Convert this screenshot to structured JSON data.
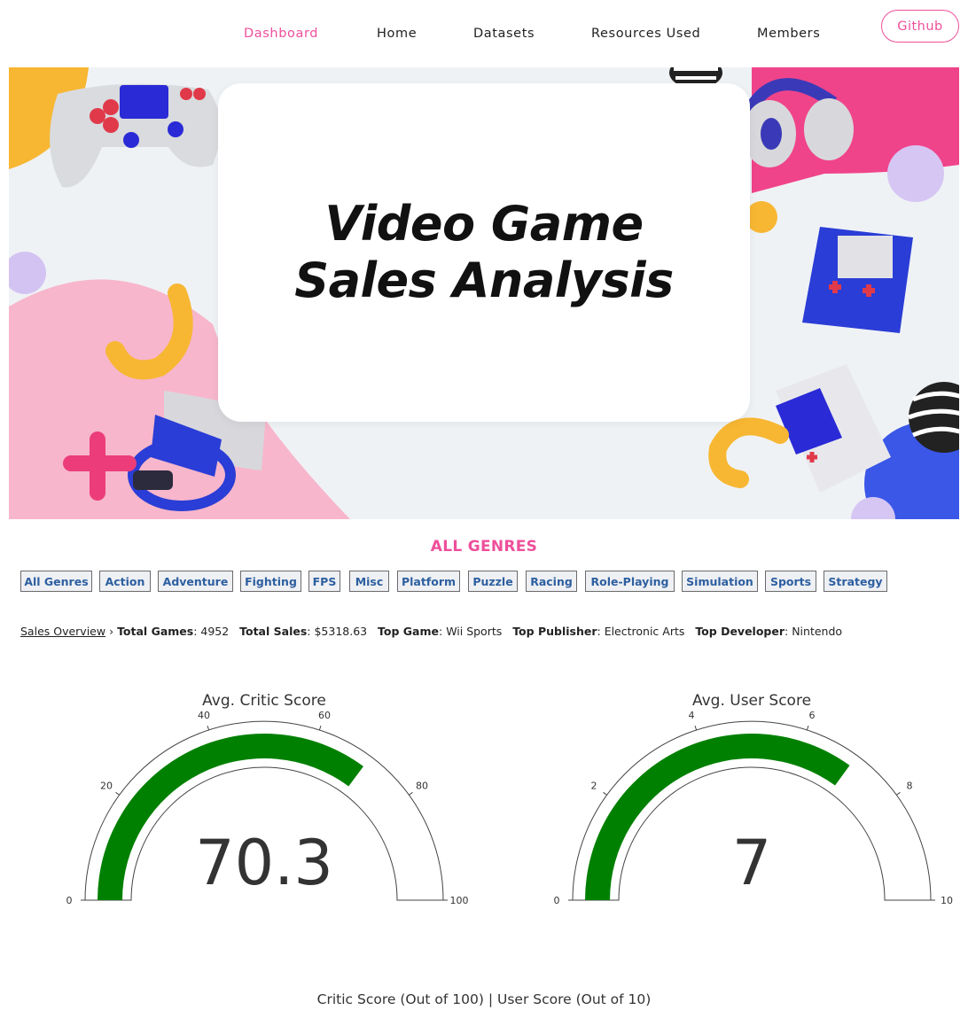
{
  "nav": {
    "items": [
      "Dashboard",
      "Home",
      "Datasets",
      "Resources Used",
      "Members"
    ],
    "active": "Dashboard",
    "github_label": "Github"
  },
  "hero": {
    "title_line1": "Video Game",
    "title_line2": "Sales Analysis"
  },
  "genres": {
    "heading": "ALL GENRES",
    "buttons": [
      "All Genres",
      "Action",
      "Adventure",
      "Fighting",
      "FPS",
      "Misc",
      "Platform",
      "Puzzle",
      "Racing",
      "Role-Playing",
      "Simulation",
      "Sports",
      "Strategy"
    ]
  },
  "stats": {
    "overview_link": "Sales Overview",
    "separator": "›",
    "total_games_label": "Total Games",
    "total_games": "4952",
    "total_sales_label": "Total Sales",
    "total_sales": "$5318.63",
    "top_game_label": "Top Game",
    "top_game": "Wii Sports",
    "top_publisher_label": "Top Publisher",
    "top_publisher": "Electronic Arts",
    "top_developer_label": "Top Developer",
    "top_developer": "Nintendo"
  },
  "colors": {
    "accent": "#ee4f9a",
    "gauge_bar": "#008000",
    "genre_text": "#2d5fa0"
  },
  "gauges": [
    {
      "title": "Avg. Critic Score",
      "value": 70.3,
      "display": "70.3",
      "min": 0,
      "max": 100,
      "ticks": [
        "0",
        "20",
        "40",
        "60",
        "80",
        "100"
      ]
    },
    {
      "title": "Avg. User Score",
      "value": 7,
      "display": "7",
      "min": 0,
      "max": 10,
      "ticks": [
        "0",
        "2",
        "4",
        "6",
        "8",
        "10"
      ]
    }
  ],
  "caption": "Critic Score (Out of 100) | User Score (Out of 10)"
}
